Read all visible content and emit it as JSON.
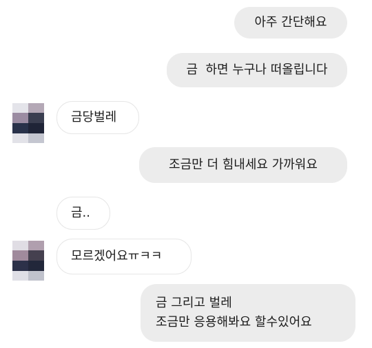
{
  "messages": [
    {
      "side": "sent",
      "text": "아주 간단해요"
    },
    {
      "side": "sent",
      "text": "금  하면 누구나 떠올립니다"
    },
    {
      "side": "received",
      "text": "금당벌레",
      "avatar": "blurred-avatar"
    },
    {
      "side": "sent",
      "text": "조금만 더 힘내세요 가까워요"
    },
    {
      "side": "received",
      "text": "금.."
    },
    {
      "side": "received",
      "text": "모르겠어요ㅠㅋㅋ",
      "avatar": "blurred-avatar"
    },
    {
      "side": "sent",
      "text": "금 그리고 벌레\n조금만 응용해봐요 할수있어요"
    }
  ],
  "colors": {
    "sent_bubble": "#ececec",
    "received_bubble_border": "#e6e6e6",
    "text": "#1c1c1c",
    "background": "#ffffff"
  }
}
